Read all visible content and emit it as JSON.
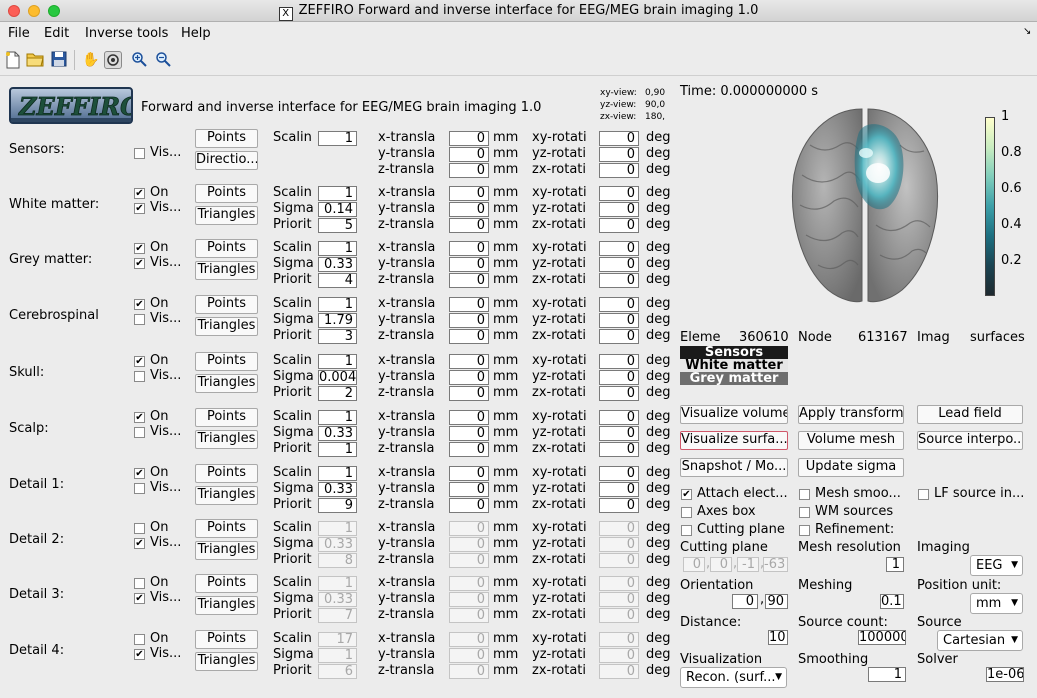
{
  "window": {
    "title": "ZEFFIRO Forward and inverse interface for EEG/MEG brain imaging 1.0"
  },
  "menu": [
    "File",
    "Edit",
    "Inverse tools",
    "Help"
  ],
  "toolbar_icons": [
    "new-file-icon",
    "open-folder-icon",
    "save-icon",
    "pan-hand-icon",
    "rotate-3d-icon",
    "zoom-in-icon",
    "zoom-out-icon"
  ],
  "header": {
    "logo": "ZEFFIRO",
    "title": "Forward and inverse interface for EEG/MEG brain imaging 1.0",
    "views": [
      {
        "label": "xy-view:",
        "value": "0,90"
      },
      {
        "label": "yz-view:",
        "value": "90,0"
      },
      {
        "label": "zx-view:",
        "value": "180,"
      }
    ]
  },
  "field_labels": {
    "on": "On",
    "visible": "Vis...",
    "points": "Points",
    "direction": "Directio...",
    "triangles": "Triangles",
    "scaling": "Scalin",
    "sigma": "Sigma",
    "priority": "Priorit",
    "x_translate": "x-transla",
    "y_translate": "y-transla",
    "z_translate": "z-transla",
    "xy_rotate": "xy-rotati",
    "yz_rotate": "yz-rotati",
    "zx_rotate": "zx-rotati",
    "mm": "mm",
    "deg": "deg"
  },
  "compartments": [
    {
      "name": "Sensors:",
      "has_on": false,
      "on": false,
      "visible": false,
      "second_button": "Directio...",
      "scaling": "1",
      "sigma": null,
      "priority": null,
      "x": "0",
      "y": "0",
      "z": "0",
      "xy": "0",
      "yz": "0",
      "zx": "0",
      "disabled": false
    },
    {
      "name": "White matter:",
      "has_on": true,
      "on": true,
      "visible": true,
      "second_button": "Triangles",
      "scaling": "1",
      "sigma": "0.14",
      "priority": "5",
      "x": "0",
      "y": "0",
      "z": "0",
      "xy": "0",
      "yz": "0",
      "zx": "0",
      "disabled": false
    },
    {
      "name": "Grey matter:",
      "has_on": true,
      "on": true,
      "visible": true,
      "second_button": "Triangles",
      "scaling": "1",
      "sigma": "0.33",
      "priority": "4",
      "x": "0",
      "y": "0",
      "z": "0",
      "xy": "0",
      "yz": "0",
      "zx": "0",
      "disabled": false
    },
    {
      "name": "Cerebrospinal",
      "has_on": true,
      "on": true,
      "visible": false,
      "second_button": "Triangles",
      "scaling": "1",
      "sigma": "1.79",
      "priority": "3",
      "x": "0",
      "y": "0",
      "z": "0",
      "xy": "0",
      "yz": "0",
      "zx": "0",
      "disabled": false
    },
    {
      "name": "Skull:",
      "has_on": true,
      "on": true,
      "visible": false,
      "second_button": "Triangles",
      "scaling": "1",
      "sigma": "0.004",
      "priority": "2",
      "x": "0",
      "y": "0",
      "z": "0",
      "xy": "0",
      "yz": "0",
      "zx": "0",
      "disabled": false
    },
    {
      "name": "Scalp:",
      "has_on": true,
      "on": true,
      "visible": false,
      "second_button": "Triangles",
      "scaling": "1",
      "sigma": "0.33",
      "priority": "1",
      "x": "0",
      "y": "0",
      "z": "0",
      "xy": "0",
      "yz": "0",
      "zx": "0",
      "disabled": false
    },
    {
      "name": "Detail 1:",
      "has_on": true,
      "on": true,
      "visible": false,
      "second_button": "Triangles",
      "scaling": "1",
      "sigma": "0.33",
      "priority": "9",
      "x": "0",
      "y": "0",
      "z": "0",
      "xy": "0",
      "yz": "0",
      "zx": "0",
      "disabled": false
    },
    {
      "name": "Detail 2:",
      "has_on": true,
      "on": false,
      "visible": true,
      "second_button": "Triangles",
      "scaling": "1",
      "sigma": "0.33",
      "priority": "8",
      "x": "0",
      "y": "0",
      "z": "0",
      "xy": "0",
      "yz": "0",
      "zx": "0",
      "disabled": true
    },
    {
      "name": "Detail 3:",
      "has_on": true,
      "on": false,
      "visible": true,
      "second_button": "Triangles",
      "scaling": "1",
      "sigma": "0.33",
      "priority": "7",
      "x": "0",
      "y": "0",
      "z": "0",
      "xy": "0",
      "yz": "0",
      "zx": "0",
      "disabled": true
    },
    {
      "name": "Detail 4:",
      "has_on": true,
      "on": false,
      "visible": true,
      "second_button": "Triangles",
      "scaling": "17",
      "sigma": "1",
      "priority": "6",
      "x": "0",
      "y": "0",
      "z": "0",
      "xy": "0",
      "yz": "0",
      "zx": "0",
      "disabled": true
    }
  ],
  "time_label": "Time: 0.000000000 s",
  "colorbar": {
    "ticks": [
      "1",
      "0.8",
      "0.6",
      "0.4",
      "0.2"
    ],
    "colormap": [
      "#ffffcc",
      "#c8ecc0",
      "#7fcdbb",
      "#3c9fa8",
      "#1d6f80",
      "#1b4452",
      "#1e2a30"
    ]
  },
  "stats": {
    "elements_label": "Eleme",
    "elements": "360610",
    "nodes_label": "Node",
    "nodes": "613167",
    "imaging_label": "Imag",
    "surfaces_label": "surfaces"
  },
  "surface_legend": [
    {
      "label": "Sensors",
      "bg": "#1a1a1a",
      "fg": "#ffffff"
    },
    {
      "label": "White matter",
      "bg": "#e6e6e6",
      "fg": "#000000"
    },
    {
      "label": "Grey matter",
      "bg": "#6e6e6e",
      "fg": "#ffffff"
    }
  ],
  "actions": {
    "visualize_volume": "Visualize volume",
    "apply_transform": "Apply transform",
    "lead_field": "Lead field",
    "visualize_surface": "Visualize surfa...",
    "volume_mesh": "Volume mesh",
    "source_interp": "Source interpo...",
    "snapshot": "Snapshot / Mo...",
    "update_sigma": "Update sigma"
  },
  "options": [
    {
      "label": "Attach elect...",
      "checked": true
    },
    {
      "label": "Mesh smoo...",
      "checked": false
    },
    {
      "label": "LF source in...",
      "checked": false
    },
    {
      "label": "Axes box",
      "checked": false
    },
    {
      "label": "WM sources",
      "checked": false
    },
    {
      "label": "Cutting plane",
      "checked": false
    },
    {
      "label": "Refinement:",
      "checked": false
    }
  ],
  "settings": {
    "cutting_plane_label": "Cutting plane",
    "cutting_plane_values": [
      "0",
      "0",
      "-1",
      "-63"
    ],
    "mesh_resolution_label": "Mesh resolution",
    "mesh_resolution": "1",
    "imaging_label": "Imaging",
    "imaging": "EEG",
    "orientation_label": "Orientation",
    "orientation_values": [
      "0",
      "90"
    ],
    "meshing_label": "Meshing",
    "meshing": "0.1",
    "position_unit_label": "Position unit:",
    "position_unit": "mm",
    "distance_label": "Distance:",
    "distance": "10",
    "source_count_label": "Source count:",
    "source_count": "100000",
    "source_label": "Source",
    "source": "Cartesian",
    "visualization_label": "Visualization",
    "visualization": "Recon. (surf...",
    "smoothing_label": "Smoothing",
    "smoothing": "1",
    "solver_label": "Solver",
    "solver": "1e-06"
  }
}
